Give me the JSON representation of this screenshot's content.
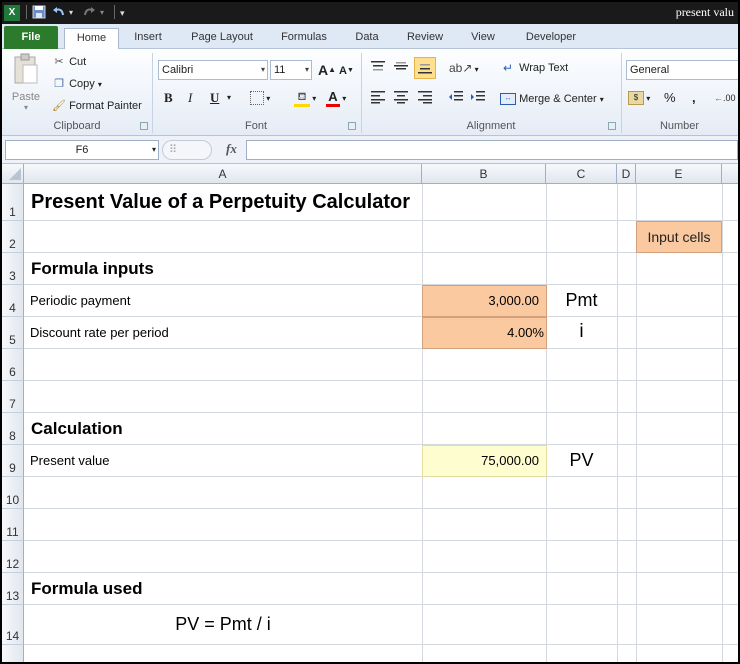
{
  "window": {
    "title": "present valu",
    "app_icon": "excel-icon"
  },
  "ribbon_tabs": [
    "File",
    "Home",
    "Insert",
    "Page Layout",
    "Formulas",
    "Data",
    "Review",
    "View",
    "Developer"
  ],
  "clipboard": {
    "paste": "Paste",
    "cut": "Cut",
    "copy": "Copy",
    "format_painter": "Format Painter",
    "label": "Clipboard"
  },
  "font": {
    "name": "Calibri",
    "size": "11",
    "bold": "B",
    "italic": "I",
    "underline": "U",
    "grow": "A",
    "shrink": "A",
    "color_letter": "A",
    "label": "Font"
  },
  "alignment": {
    "wrap_text": "Wrap Text",
    "merge_center": "Merge & Center",
    "label": "Alignment"
  },
  "number": {
    "format": "General",
    "percent": "%",
    "comma": ",",
    "increase_decimal": ".00",
    "label": "Number"
  },
  "formula_bar": {
    "name_box": "F6",
    "fx": "fx",
    "content": ""
  },
  "columns": [
    "A",
    "B",
    "C",
    "D",
    "E"
  ],
  "rows": [
    "1",
    "2",
    "3",
    "4",
    "5",
    "6",
    "7",
    "8",
    "9",
    "10",
    "11",
    "12",
    "13",
    "14"
  ],
  "sheet": {
    "title": "Present Value of a Perpetuity Calculator",
    "legend_input": "Input cells",
    "section_inputs": "Formula inputs",
    "periodic_payment_label": "Periodic payment",
    "periodic_payment_value": "3,000.00",
    "periodic_payment_symbol": "Pmt",
    "discount_rate_label": "Discount rate per period",
    "discount_rate_value": "4.00%",
    "discount_rate_symbol": "i",
    "section_calculation": "Calculation",
    "present_value_label": "Present value",
    "present_value_value": "75,000.00",
    "present_value_symbol": "PV",
    "section_formula": "Formula used",
    "formula": "PV = Pmt / i"
  },
  "colors": {
    "input_cell": "#fbc9a0",
    "output_cell": "#fefdd0",
    "file_tab": "#2c7a2c"
  }
}
